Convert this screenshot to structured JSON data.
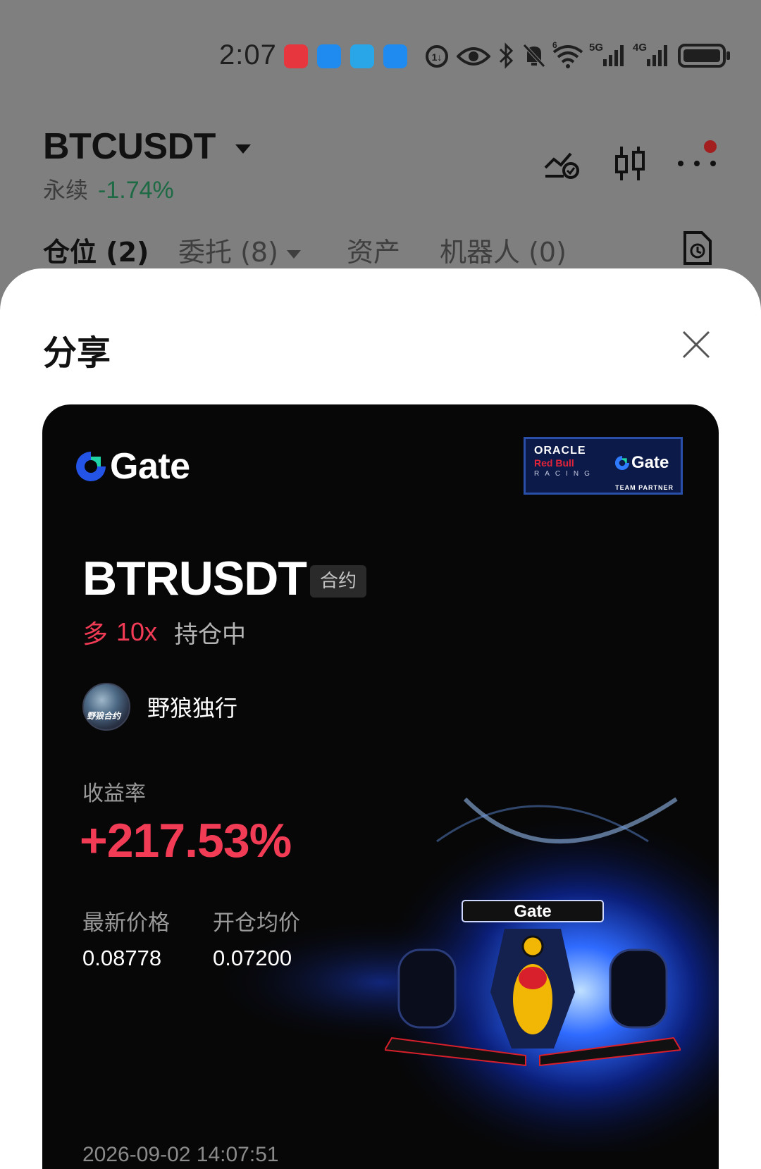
{
  "status_bar": {
    "time": "2:07",
    "network_5g": "5G",
    "network_4g": "4G",
    "wifi_gen": "6"
  },
  "header": {
    "pair": "BTCUSDT",
    "market_type": "永续",
    "change_pct": "-1.74%",
    "change_color": "#1d6a45"
  },
  "tabs": [
    {
      "label": "仓位 (2)"
    },
    {
      "label": "委托 (8)"
    },
    {
      "label": "资产"
    },
    {
      "label": "机器人 (0)"
    }
  ],
  "share_sheet": {
    "title": "分享",
    "card": {
      "brand": "Gate",
      "partner_badge": {
        "oracle": "ORACLE",
        "redbull": "Red Bull",
        "racing": "RACING",
        "gate": "Gate",
        "team_partner": "TEAM PARTNER"
      },
      "symbol": "BTRUSDT",
      "contract_tag": "合约",
      "direction": "多",
      "leverage": "10x",
      "position_status": "持仓中",
      "user": {
        "name": "野狼独行",
        "avatar_text": "野狼合约"
      },
      "roi_label": "收益率",
      "roi_value": "+217.53%",
      "latest_price_label": "最新价格",
      "latest_price": "0.08778",
      "entry_price_label": "开仓均价",
      "entry_price": "0.07200",
      "timestamp": "2026-09-02 14:07:51"
    }
  },
  "colors": {
    "accent_red": "#f23b55",
    "gate_blue": "#2354e6",
    "overlay_gray": "#7f7f7f"
  },
  "icons": [
    "close-icon",
    "price-alert-icon",
    "candlestick-icon",
    "more-icon",
    "history-doc-icon",
    "bluetooth-icon",
    "eye-icon",
    "mute-icon",
    "wifi-icon",
    "battery-icon"
  ]
}
